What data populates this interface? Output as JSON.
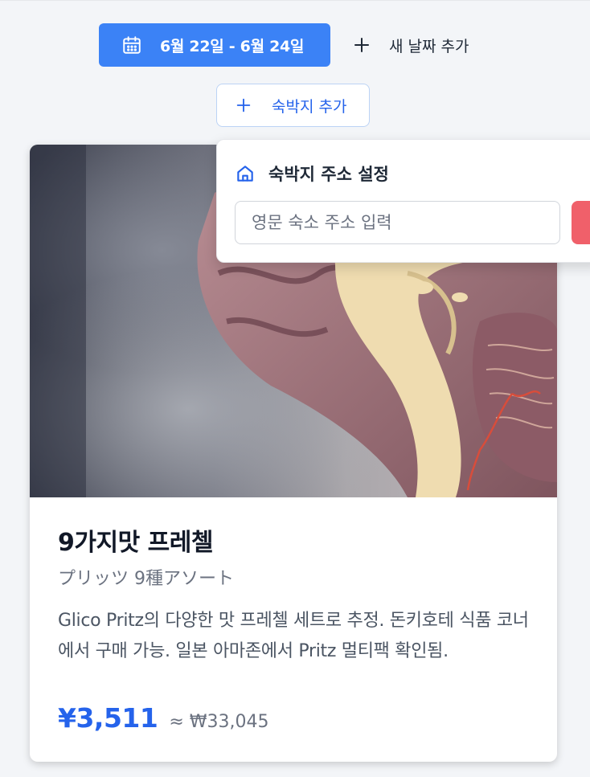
{
  "date_range": {
    "label": "6월 22일 - 6월 24일",
    "icon": "calendar-icon"
  },
  "add_date": {
    "label": "새 날짜 추가",
    "icon": "plus-icon"
  },
  "add_lodging": {
    "label": "숙박지 추가",
    "icon": "plus-icon"
  },
  "lodging_popup": {
    "title": "숙박지 주소 설정",
    "icon": "home-icon",
    "input_value": "",
    "input_placeholder": "영문 숙소 주소 입력"
  },
  "product": {
    "title": "9가지맛 프레첼",
    "subtitle": "プリッツ 9種アソート",
    "description": "Glico Pritz의 다양한 맛 프레첼 세트로 추정. 돈키호테 식품 코너에서 구매 가능. 일본 아마존에서 Pritz 멀티팩 확인됨.",
    "price_jpy": "¥3,511",
    "price_krw_approx": "≈ ₩33,045"
  },
  "colors": {
    "accent": "#3b82f6",
    "accent_text": "#2563eb",
    "danger": "#f0606a",
    "background": "#f3f5f8"
  }
}
